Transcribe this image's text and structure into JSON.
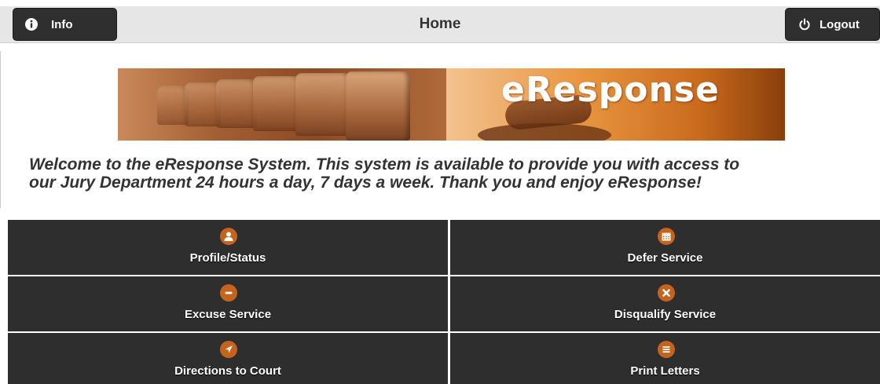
{
  "header": {
    "title": "Home",
    "info_label": "Info",
    "logout_label": "Logout"
  },
  "banner": {
    "brand_text": "eResponse"
  },
  "welcome": {
    "line1": "Welcome to the eResponse System. This system is available to provide you with access to",
    "line2": "our Jury Department 24 hours a day, 7 days a week. Thank you and enjoy eResponse!"
  },
  "menu": {
    "items": [
      {
        "label": "Profile/Status",
        "icon": "user-icon"
      },
      {
        "label": "Defer Service",
        "icon": "calendar-icon"
      },
      {
        "label": "Excuse Service",
        "icon": "minus-icon"
      },
      {
        "label": "Disqualify Service",
        "icon": "close-icon"
      },
      {
        "label": "Directions to Court",
        "icon": "navigation-arrow-icon"
      },
      {
        "label": "Print Letters",
        "icon": "list-icon"
      }
    ]
  },
  "colors": {
    "header_bg": "#e6e6e6",
    "button_bg": "#2f2f2f",
    "tile_bg": "#2e2e2e",
    "icon_accent": "#c5641e"
  }
}
